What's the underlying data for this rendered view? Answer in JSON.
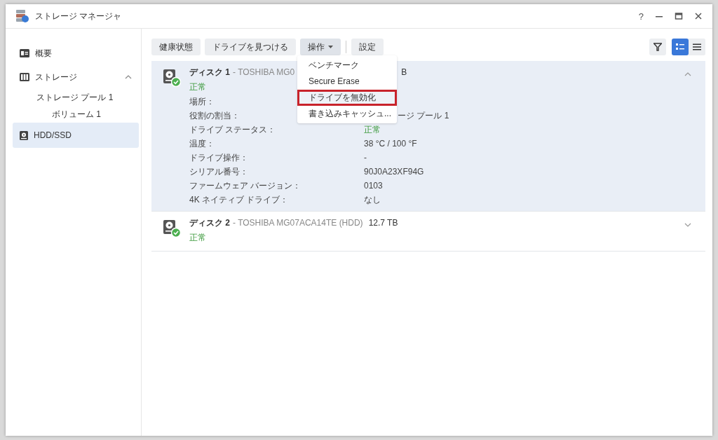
{
  "window": {
    "title": "ストレージ マネージャ",
    "help": "?"
  },
  "sidebar": {
    "items": [
      {
        "label": "概要",
        "kind": "overview",
        "selected": false
      },
      {
        "label": "ストレージ",
        "kind": "storage",
        "selected": false,
        "expanded": true,
        "children": [
          {
            "label": "ストレージ プール 1",
            "selected": false,
            "children": [
              {
                "label": "ボリューム 1",
                "selected": false
              }
            ]
          }
        ]
      },
      {
        "label": "HDD/SSD",
        "kind": "drive",
        "selected": true
      }
    ]
  },
  "toolbar": {
    "buttons": [
      {
        "label": "健康状態",
        "kind": "button"
      },
      {
        "label": "ドライブを見つける",
        "kind": "button"
      },
      {
        "label": "操作",
        "kind": "dropdown",
        "open": true
      },
      {
        "label": "設定",
        "kind": "button"
      }
    ],
    "view_modes": [
      {
        "kind": "detail",
        "selected": true
      },
      {
        "kind": "list",
        "selected": false
      }
    ]
  },
  "menu": {
    "items": [
      {
        "label": "ベンチマーク",
        "highlighted": false
      },
      {
        "label": "Secure Erase",
        "highlighted": false
      },
      {
        "label": "ドライブを無効化",
        "highlighted": true
      },
      {
        "label": "書き込みキャッシュ...",
        "highlighted": false
      }
    ]
  },
  "disks": [
    {
      "name": "ディスク 1",
      "model": "- TOSHIBA MG0",
      "size_tail": "B",
      "status": "正常",
      "healthy": true,
      "expanded": true,
      "details": [
        {
          "label": "場所："
        },
        {
          "label": "役割の割当：",
          "value_tail": "ージ プール 1"
        },
        {
          "label": "ドライブ ステータス：",
          "value": "正常",
          "kind": "status"
        },
        {
          "label": "温度：",
          "value": "38 °C / 100 °F"
        },
        {
          "label": "ドライブ操作：",
          "value": "-"
        },
        {
          "label": "シリアル番号：",
          "value": "90J0A23XF94G"
        },
        {
          "label": "ファームウェア バージョン：",
          "value": "0103"
        },
        {
          "label": "4K ネイティブ ドライブ：",
          "value": "なし"
        }
      ]
    },
    {
      "name": "ディスク 2",
      "model": "- TOSHIBA MG07ACA14TE (HDD)",
      "size": "12.7 TB",
      "status": "正常",
      "healthy": true,
      "expanded": false
    }
  ]
}
